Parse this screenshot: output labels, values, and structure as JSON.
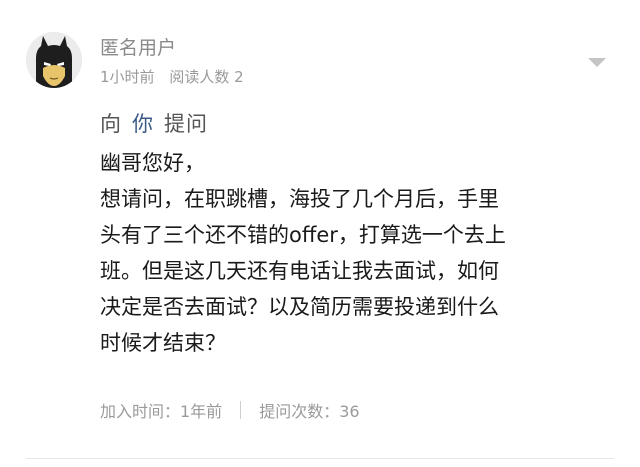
{
  "question": {
    "author": {
      "name": "匿名用户",
      "avatar_icon": "batman-avatar-icon"
    },
    "meta": {
      "time_ago": "1小时前",
      "read_count": "阅读人数 2"
    },
    "ask_line": {
      "prefix": "向",
      "target": "你",
      "suffix": "提问"
    },
    "greeting": "幽哥您好，",
    "body_lines": [
      "想请问，在职跳槽，海投了几个月后，手里",
      "头有了三个还不错的offer，打算选一个去上",
      "班。但是这几天还有电话让我去面试，如何",
      "决定是否去面试？以及简历需要投递到什么",
      "时候才结束？"
    ],
    "footer": {
      "joined": "加入时间：1年前",
      "question_count": "提问次数：36"
    },
    "menu_icon": "chevron-down-icon"
  }
}
